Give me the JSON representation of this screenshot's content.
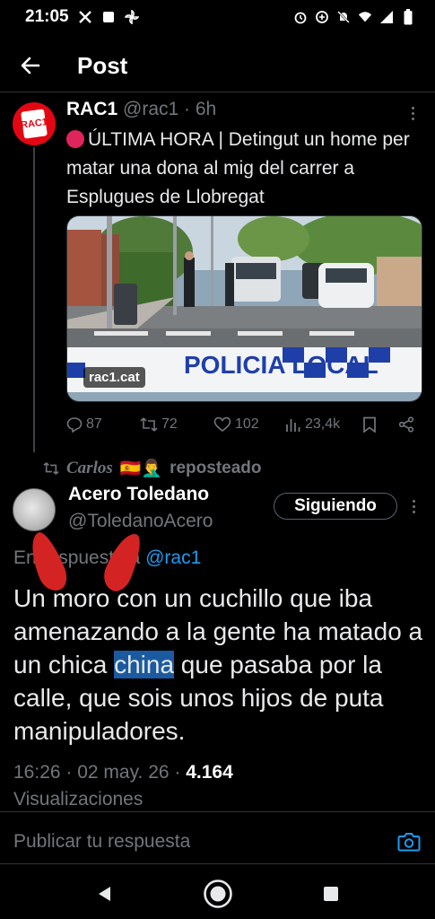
{
  "status": {
    "time": "21:05",
    "left_icons": [
      "x-logo-icon",
      "square-notification-icon",
      "pinwheel-icon"
    ],
    "right_icons": [
      "alarm-icon",
      "data-saver-icon",
      "mute-icon",
      "wifi-icon",
      "signal-icon",
      "battery-icon"
    ]
  },
  "header": {
    "title": "Post",
    "back_icon": "arrow-left-icon"
  },
  "quoted_post": {
    "name": "RAC1",
    "handle_time": "@rac1 · 6h",
    "avatar_text": "RAC1",
    "text": "ÚLTIMA HORA | Detingut un home per matar una dona al mig del carrer a Esplugues de Llobregat",
    "image_tag": "rac1.cat",
    "image_tape_text": "POLICIA LOCAL",
    "stats": {
      "replies": "87",
      "reposts": "72",
      "likes": "102",
      "views": "23,4k"
    }
  },
  "repost": {
    "name": "Carlos",
    "emojis": "🇪🇸🤦‍♂️",
    "label": "reposteado"
  },
  "reply_post": {
    "name": "Acero Toledano",
    "handle": "@ToledanoAcero",
    "follow_label": "Siguiendo",
    "reply_prefix": "En respuesta a",
    "reply_mention": "@rac1",
    "text_before": "Un moro con un cuchillo que iba amenazando a la gente ha matado a un chica ",
    "text_highlight": "china",
    "text_after": " que pasaba por la calle, que sois unos hijos de puta manipuladores.",
    "timestamp": "16:26 · 02 may. 26 · ",
    "views_count": "4.164",
    "views_label": "Visualizaciones"
  },
  "compose": {
    "placeholder": "Publicar tu respuesta"
  },
  "colors": {
    "accent": "#1d9bf0",
    "muted": "#71767b",
    "divider": "#2f3336",
    "rac1_red": "#e30613"
  }
}
